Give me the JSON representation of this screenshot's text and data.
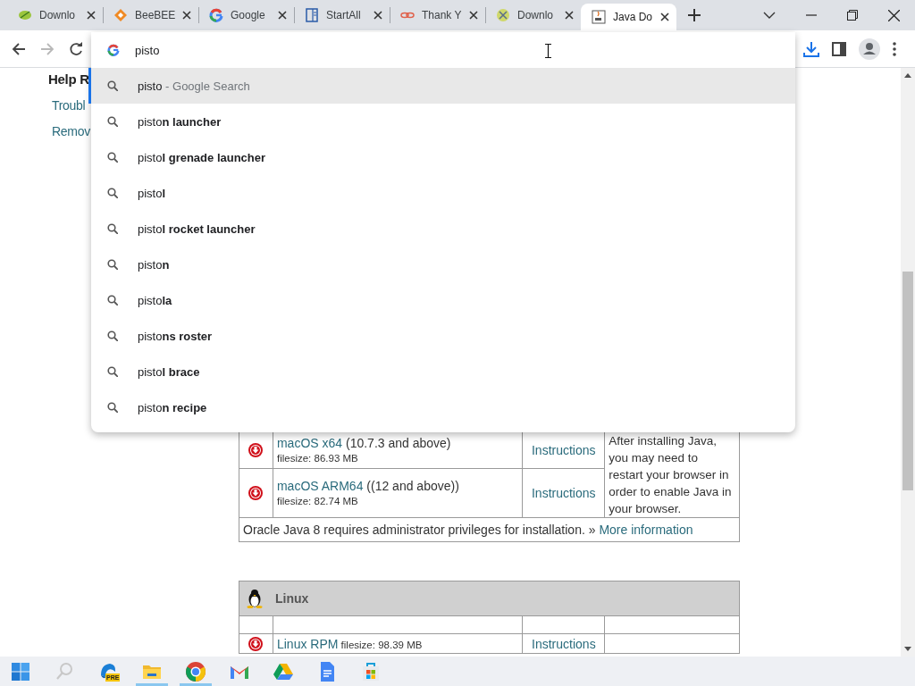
{
  "tabs": [
    {
      "title": "Downlo",
      "selected": false
    },
    {
      "title": "BeeBEE",
      "selected": false
    },
    {
      "title": "Google",
      "selected": false
    },
    {
      "title": "StartAll",
      "selected": false
    },
    {
      "title": "Thank Y",
      "selected": false
    },
    {
      "title": "Downlo",
      "selected": false
    },
    {
      "title": "Java Do",
      "selected": true
    }
  ],
  "toolbar": {
    "forward_disabled": true
  },
  "omnibox": {
    "value": "pisto"
  },
  "suggestions": [
    {
      "text": "pisto",
      "detail": "- Google Search",
      "selected": true
    },
    {
      "text": "pisto**n launcher**",
      "selected": false
    },
    {
      "text": "pisto**l grenade launcher**",
      "selected": false
    },
    {
      "text": "pisto**l**",
      "selected": false
    },
    {
      "text": "pisto**l rocket launcher**",
      "selected": false
    },
    {
      "text": "pisto**n**",
      "selected": false
    },
    {
      "text": "pisto**la**",
      "selected": false
    },
    {
      "text": "pisto**ns roster**",
      "selected": false
    },
    {
      "text": "pisto**l brace**",
      "selected": false
    },
    {
      "text": "pisto**n recipe**",
      "selected": false
    }
  ],
  "page": {
    "heading": "Help R",
    "links": [
      "Troubl",
      "Remov"
    ],
    "mac_table": {
      "rows": [
        {
          "name": "macOS x64",
          "detail": "(10.7.3 and above)",
          "filesize": "filesize: 86.93 MB",
          "instructions": "Instructions"
        },
        {
          "name": "macOS ARM64",
          "detail": "((12 and above))",
          "filesize": "filesize: 82.74 MB",
          "instructions": "Instructions"
        }
      ],
      "note": "After installing Java, you may need to restart your browser in order to enable Java in your browser.",
      "footer": {
        "text": "Oracle Java 8 requires administrator privileges for installation. »",
        "link": "More information"
      }
    },
    "linux_table": {
      "title": "Linux",
      "rows": [
        {
          "name": "Linux RPM",
          "filesize": "filesize: 98.39 MB",
          "instructions": "Instructions"
        }
      ]
    }
  },
  "taskbar": {
    "items": [
      {
        "running": false
      },
      {
        "running": false
      },
      {
        "running": false,
        "badge": "PRE"
      },
      {
        "running": true
      },
      {
        "running": true
      },
      {
        "running": false
      },
      {
        "running": false
      },
      {
        "running": false
      },
      {
        "running": false
      }
    ]
  }
}
